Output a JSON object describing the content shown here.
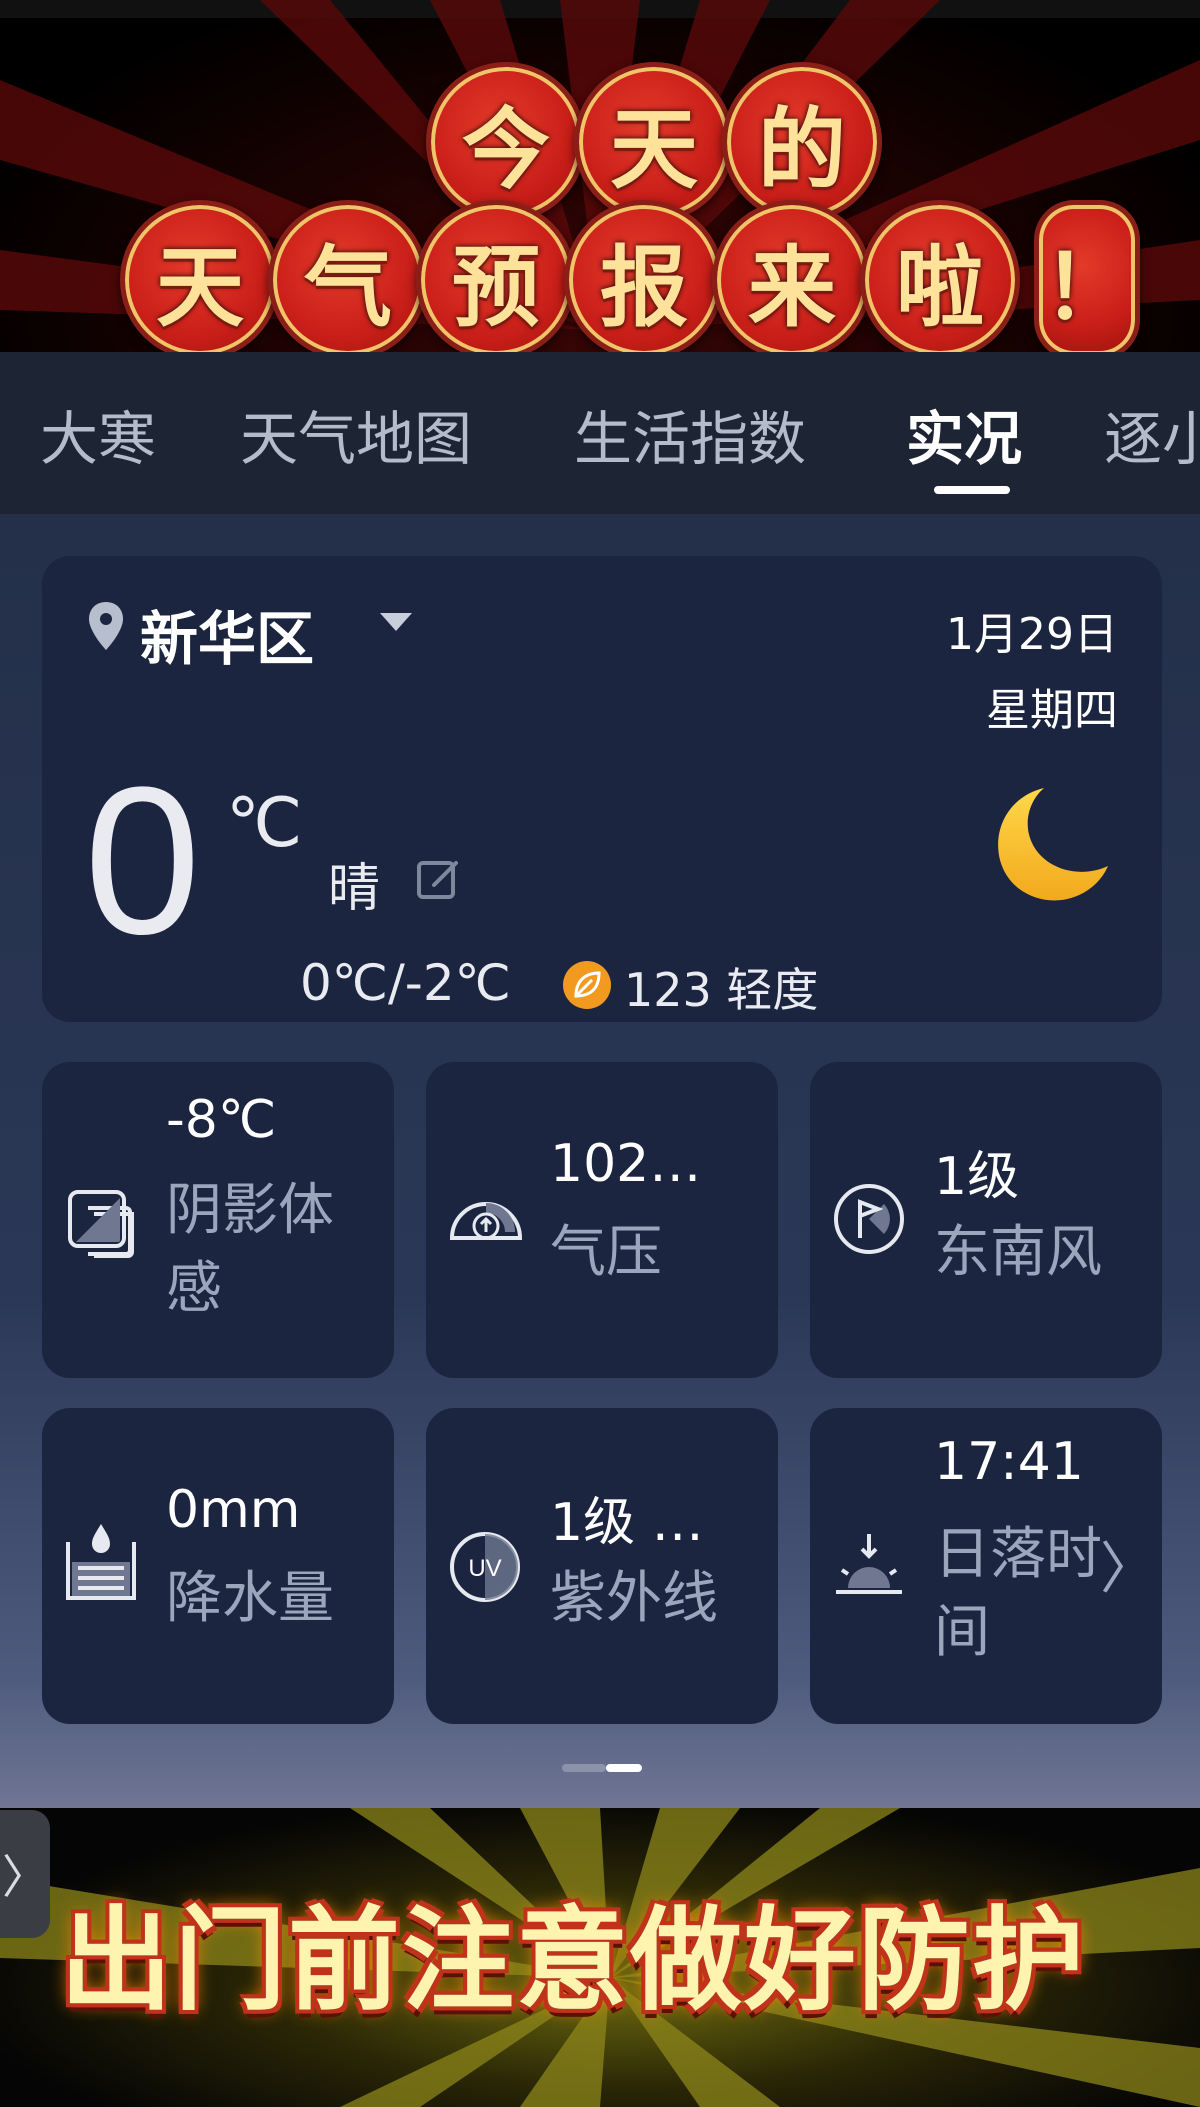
{
  "banner": {
    "title_line1": [
      "今",
      "天",
      "的"
    ],
    "title_line2": [
      "天",
      "气",
      "预",
      "报",
      "来",
      "啦",
      "！"
    ]
  },
  "tabs": [
    {
      "label": "大寒",
      "active": false
    },
    {
      "label": "天气地图",
      "active": false
    },
    {
      "label": "生活指数",
      "active": false
    },
    {
      "label": "实况",
      "active": true
    },
    {
      "label": "逐小",
      "active": false
    }
  ],
  "location": {
    "name": "新华区",
    "icon": "location-pin-icon",
    "dropdown_icon": "caret-down-icon"
  },
  "date": {
    "date": "1月29日",
    "weekday": "星期四"
  },
  "current": {
    "temperature": "0",
    "unit": "℃",
    "condition": "晴",
    "range": "0℃/-2℃",
    "aqi": "123 轻度",
    "weather_icon": "moon-icon",
    "aqi_color": "#f29a1f"
  },
  "tiles": [
    {
      "value": "-8℃",
      "label": "阴影体感",
      "icon": "feels-like-icon"
    },
    {
      "value": "102…",
      "label": "气压",
      "icon": "pressure-icon"
    },
    {
      "value": "1级",
      "label": "东南风",
      "icon": "wind-icon"
    },
    {
      "value": "0mm",
      "label": "降水量",
      "icon": "precipitation-icon"
    },
    {
      "value": "1级 …",
      "label": "紫外线",
      "icon": "uv-icon"
    },
    {
      "value": "17:41",
      "label": "日落时间",
      "icon": "sunset-icon",
      "chevron": "〉"
    }
  ],
  "bottom": {
    "side_handle": "〉",
    "slogan": "出门前注意做好防护"
  },
  "colors": {
    "panel_bg": "#243049",
    "card_bg": "#1c2540",
    "tab_bar_bg": "#1d2433",
    "moon": "#f6c33a",
    "coin_red": "#c81e18"
  }
}
